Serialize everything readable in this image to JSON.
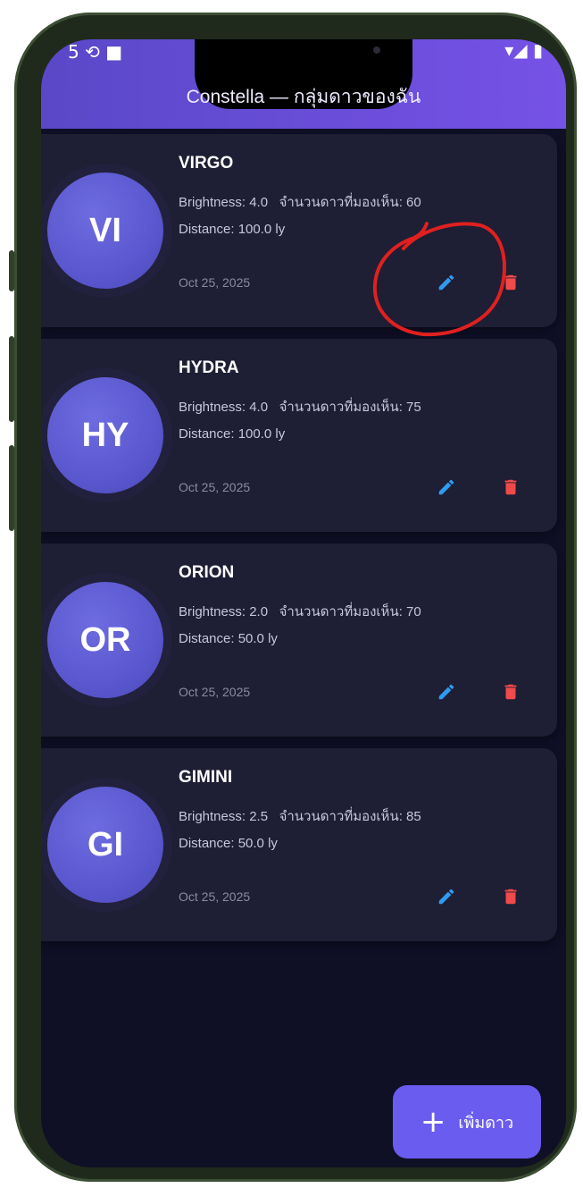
{
  "status_bar": {
    "left_icons": "5 ⟲ ■",
    "right_icons": "▾◢ ▮"
  },
  "app_bar": {
    "title": "Constella — กลุ่มดาวของฉัน"
  },
  "labels": {
    "brightness": "Brightness:",
    "visible_stars": "จำนวนดาวที่มองเห็น:",
    "distance": "Distance:",
    "distance_unit": "ly"
  },
  "constellations": [
    {
      "initials": "VI",
      "name": "VIRGO",
      "brightness": "4.0",
      "visible_stars": "60",
      "distance": "100.0",
      "date": "Oct 25, 2025"
    },
    {
      "initials": "HY",
      "name": "HYDRA",
      "brightness": "4.0",
      "visible_stars": "75",
      "distance": "100.0",
      "date": "Oct 25, 2025"
    },
    {
      "initials": "OR",
      "name": "ORION",
      "brightness": "2.0",
      "visible_stars": "70",
      "distance": "50.0",
      "date": "Oct 25, 2025"
    },
    {
      "initials": "GI",
      "name": "GIMINI",
      "brightness": "2.5",
      "visible_stars": "85",
      "distance": "50.0",
      "date": "Oct 25, 2025"
    }
  ],
  "fab": {
    "icon": "+",
    "label": "เพิ่มดาว"
  },
  "icons": {
    "edit": "pencil-icon",
    "delete": "trash-icon"
  },
  "colors": {
    "app_bar_start": "#5a48c8",
    "app_bar_end": "#7652e6",
    "background": "#0f0f26",
    "card": "#1e1e34",
    "avatar": "#5b57cf",
    "edit_icon": "#2f9bf0",
    "delete_icon": "#f04a4a",
    "fab": "#6b5cf0",
    "annotation": "#e02020"
  }
}
